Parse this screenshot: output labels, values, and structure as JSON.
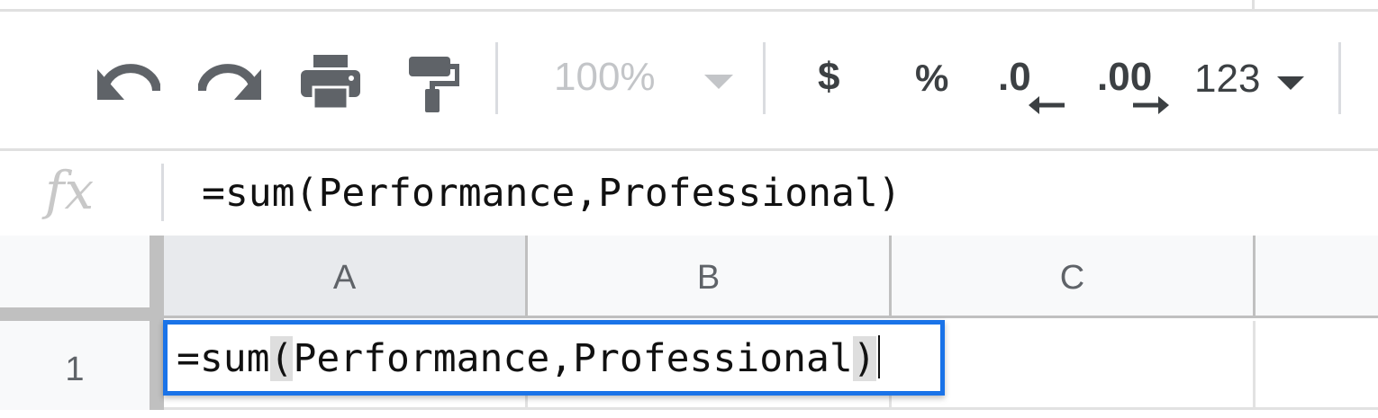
{
  "toolbar": {
    "undo_icon": "undo-icon",
    "redo_icon": "redo-icon",
    "print_icon": "print-icon",
    "paint_format_icon": "paint-format-icon",
    "zoom_value": "100%",
    "currency_label": "$",
    "percent_label": "%",
    "decrease_decimal_label": ".0",
    "increase_decimal_label": ".00",
    "number_format_label": "123"
  },
  "formula_bar": {
    "fx_label": "fx",
    "formula": "=sum(Performance,Professional)"
  },
  "grid": {
    "columns": [
      "A",
      "B",
      "C"
    ],
    "rows": [
      "1"
    ],
    "editor": {
      "prefix": "=sum",
      "open_paren": "(",
      "args": "Performance,Professional",
      "close_paren": ")"
    }
  },
  "colors": {
    "selection": "#1a73e8",
    "icon": "#5f6368",
    "disabled": "#c3c5c8"
  }
}
